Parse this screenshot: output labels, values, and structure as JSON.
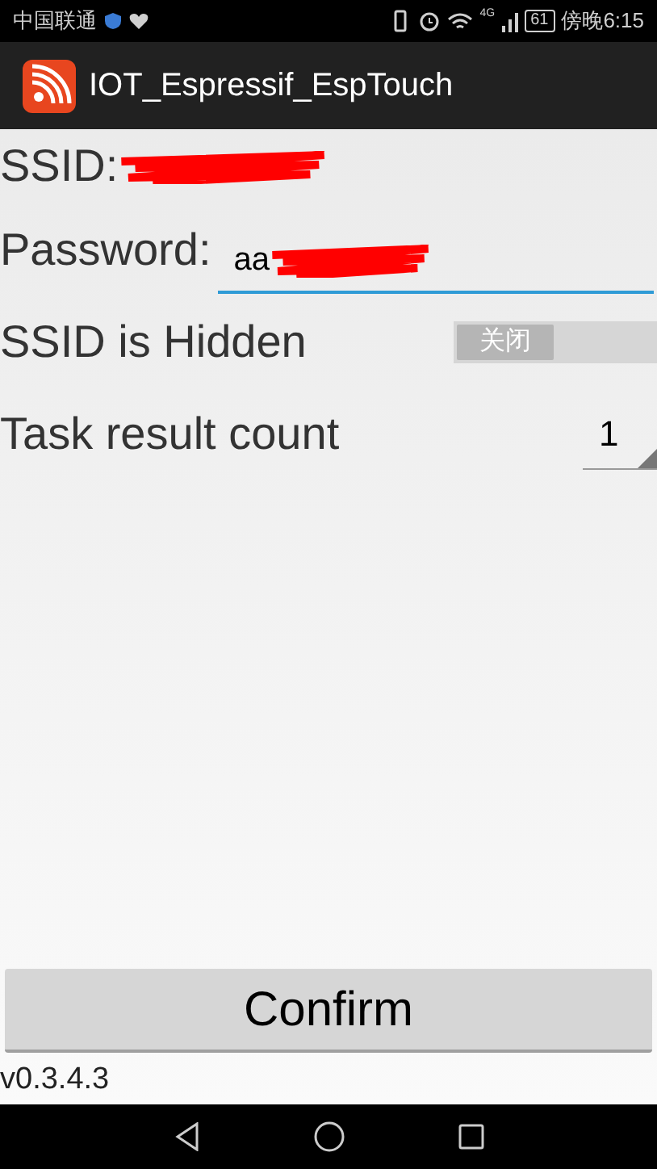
{
  "status_bar": {
    "carrier": "中国联通",
    "network": "4G",
    "battery": "61",
    "time": "傍晚6:15"
  },
  "app_bar": {
    "title": "IOT_Espressif_EspTouch"
  },
  "ssid": {
    "label": "SSID:"
  },
  "password": {
    "label": "Password:",
    "value": "aa"
  },
  "hidden": {
    "label": "SSID is Hidden",
    "on": false,
    "switch_text": "关闭"
  },
  "task_count": {
    "label": "Task result count",
    "value": "1"
  },
  "confirm": {
    "label": "Confirm"
  },
  "version": "v0.3.4.3"
}
